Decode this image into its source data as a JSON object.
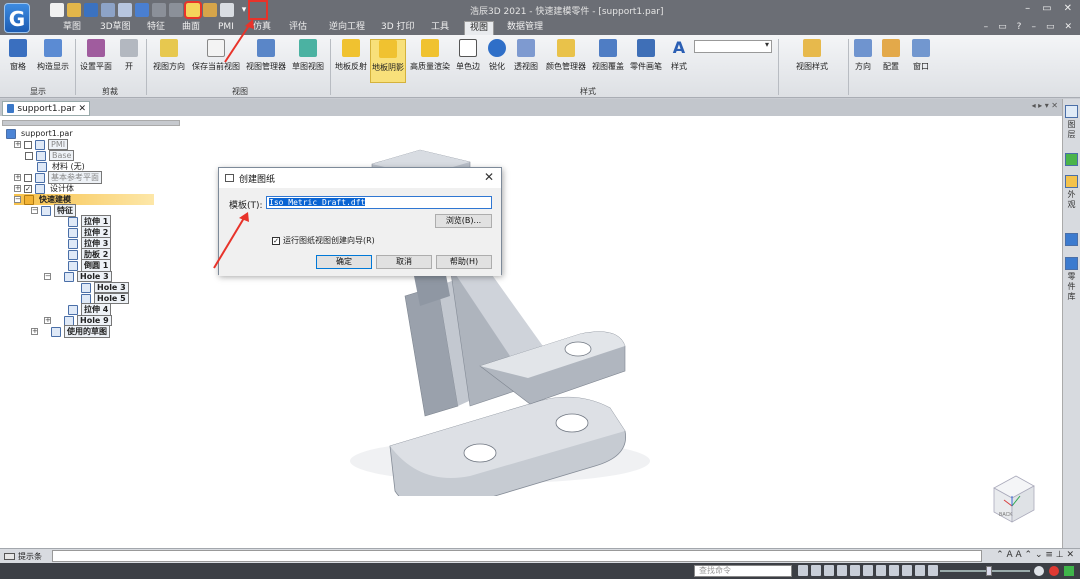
{
  "app": {
    "title": "浩辰3D 2021 - 快速建模零件 - [support1.par]",
    "logo_letter": "G"
  },
  "window_controls": [
    "–",
    "▭",
    "✕"
  ],
  "tab_controls": [
    "–",
    "▭",
    "?",
    "–",
    "▭",
    "✕"
  ],
  "ribbon_tabs": [
    "草图",
    "3D草图",
    "特征",
    "曲面",
    "PMI",
    "仿真",
    "评估",
    "逆向工程",
    "3D 打印",
    "工具",
    "视图",
    "数据管理"
  ],
  "active_tab": "视图",
  "ribbon": {
    "buttons": [
      "窗格",
      "构造显示",
      "设置平面",
      "开",
      "视图方向",
      "保存当前视图",
      "视图管理器",
      "草图视图",
      "地板反射",
      "地板阴影",
      "高质量渲染",
      "单色边",
      "锐化",
      "透视图",
      "颜色管理器",
      "视图覆盖",
      "零件画笔",
      "样式",
      "视图样式",
      "方向",
      "配置",
      "窗口"
    ],
    "groups": [
      "显示",
      "剪裁",
      "视图",
      "样式"
    ]
  },
  "document_tab": {
    "label": "support1.par",
    "close": "✕",
    "controls": "◂ ▸ ▾ ✕"
  },
  "tree": {
    "items": [
      {
        "label": "support1.par"
      },
      {
        "label": "PMI"
      },
      {
        "label": "Base"
      },
      {
        "label": "材料 (无)"
      },
      {
        "label": "基本参考平面"
      },
      {
        "label": "设计体"
      },
      {
        "label": "快速建模"
      },
      {
        "label": "特征"
      },
      {
        "label": "拉伸 1"
      },
      {
        "label": "拉伸 2"
      },
      {
        "label": "拉伸 3"
      },
      {
        "label": "肋板 2"
      },
      {
        "label": "倒圆 1"
      },
      {
        "label": "Hole 3"
      },
      {
        "label": "Hole 3"
      },
      {
        "label": "Hole 5"
      },
      {
        "label": "拉伸 4"
      },
      {
        "label": "Hole 9"
      },
      {
        "label": "使用的草图"
      }
    ]
  },
  "dialog": {
    "title": "创建图纸",
    "close": "✕",
    "template_label": "模板(T):",
    "template_value": "Iso Metric Draft.dft",
    "browse_button": "浏览(B)...",
    "checkbox_label": "运行图纸视图创建向导(R)",
    "checkbox_checked": true,
    "ok_button": "确定",
    "cancel_button": "取消",
    "help_button": "帮助(H)"
  },
  "view_cube": {
    "label": "BACK"
  },
  "right_panel": {
    "items": [
      "图层",
      "",
      "外观",
      "",
      "零件库"
    ]
  },
  "prompt_bar": {
    "label": "提示条",
    "controls": "⌃ A A ⌃ ⌄ ≡ ⊥ ✕"
  },
  "status_bar": {
    "search_placeholder": "查找命令"
  },
  "colors": {
    "highlight_red": "#e8332a",
    "selection_blue": "#0a64d3",
    "ribbon_selected": "#f8e07a",
    "tree_highlight": "#f7c14a"
  }
}
